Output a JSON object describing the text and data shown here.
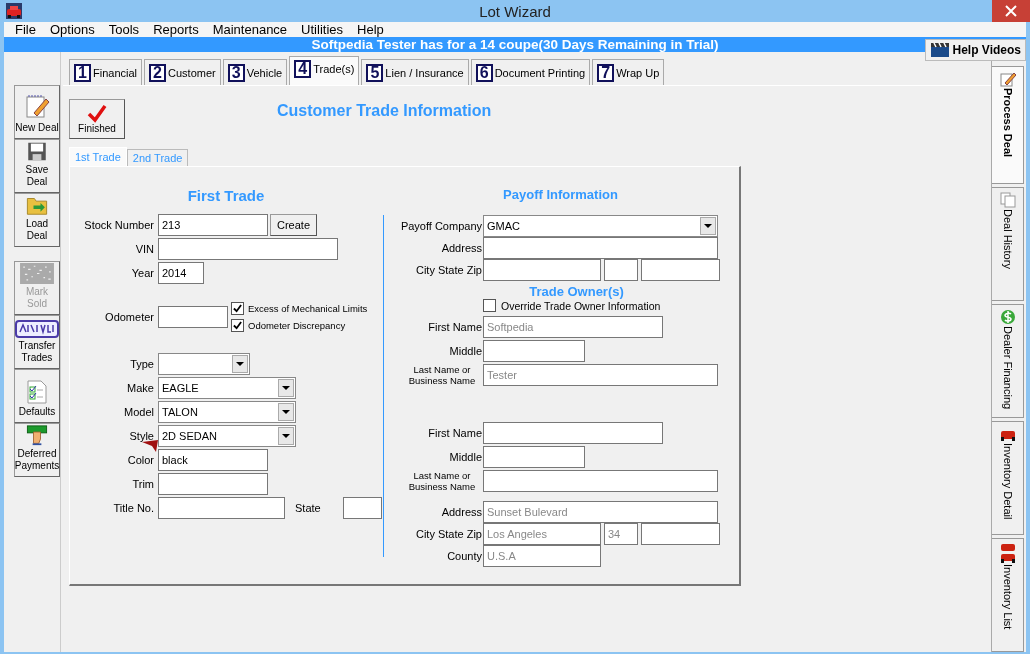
{
  "window": {
    "title": "Lot Wizard"
  },
  "menu": [
    "File",
    "Options",
    "Tools",
    "Reports",
    "Maintenance",
    "Utilities",
    "Help"
  ],
  "banner": {
    "text": "Softpedia Tester has  for a 14  coupe(30 Days Remaining in Trial)",
    "help_button": "Help Videos"
  },
  "tabs": [
    {
      "number": "1",
      "label": "Financial",
      "selected": false
    },
    {
      "number": "2",
      "label": "Customer",
      "selected": false
    },
    {
      "number": "3",
      "label": "Vehicle",
      "selected": false
    },
    {
      "number": "4",
      "label": "Trade(s)",
      "selected": true
    },
    {
      "number": "5",
      "label": "Lien / Insurance",
      "selected": false
    },
    {
      "number": "6",
      "label": "Document Printing",
      "selected": false
    },
    {
      "number": "7",
      "label": "Wrap Up",
      "selected": false
    }
  ],
  "sidebar": [
    {
      "label": "New Deal",
      "kind": "new",
      "disabled": false
    },
    {
      "label": "Save Deal",
      "kind": "save",
      "disabled": false
    },
    {
      "label": "Load Deal",
      "kind": "load",
      "disabled": false
    },
    {
      "label": "Mark Sold",
      "kind": "sold",
      "disabled": true
    },
    {
      "label": "Transfer Trades",
      "kind": "stamp",
      "disabled": false
    },
    {
      "label": "Defaults",
      "kind": "checklist",
      "disabled": false
    },
    {
      "label": "Deferred Payments",
      "kind": "money",
      "disabled": false
    }
  ],
  "side_tabs": [
    {
      "label": "Process Deal",
      "kind": "pencil",
      "selected": true
    },
    {
      "label": "Deal History",
      "kind": "pages",
      "selected": false
    },
    {
      "label": "Dealer Financing",
      "kind": "dollar",
      "selected": false
    },
    {
      "label": "Inventory Detail",
      "kind": "car",
      "selected": false
    },
    {
      "label": "Inventory List",
      "kind": "cars",
      "selected": false
    }
  ],
  "finished_button": "Finished",
  "page_title": "Customer Trade Information",
  "trade_tabs": [
    {
      "label": "1st Trade",
      "selected": true
    },
    {
      "label": "2nd Trade",
      "selected": false
    }
  ],
  "first_trade": {
    "title": "First Trade",
    "create_button": "Create",
    "stock_number": {
      "label": "Stock Number",
      "value": "213"
    },
    "vin": {
      "label": "VIN"
    },
    "year": {
      "label": "Year",
      "value": "2014"
    },
    "odometer": {
      "label": "Odometer"
    },
    "checks": [
      {
        "label": "Excess of Mechanical Limits",
        "checked": true
      },
      {
        "label": "Odometer Discrepancy",
        "checked": true
      }
    ],
    "type": {
      "label": "Type"
    },
    "make": {
      "label": "Make",
      "value": "EAGLE"
    },
    "model": {
      "label": "Model",
      "value": "TALON"
    },
    "style": {
      "label": "Style",
      "value": "2D SEDAN"
    },
    "color": {
      "label": "Color",
      "value": "black"
    },
    "trim": {
      "label": "Trim"
    },
    "title_no": {
      "label": "Title No."
    },
    "state": {
      "label": "State"
    }
  },
  "payoff": {
    "title": "Payoff Information",
    "company": {
      "label": "Payoff Company",
      "value": "GMAC"
    },
    "address": {
      "label": "Address"
    },
    "city_state_zip": {
      "label": "City State Zip"
    }
  },
  "trade_owners": {
    "title": "Trade Owner(s)",
    "override": {
      "label": "Override Trade Owner Information",
      "checked": false
    },
    "owners": [
      {
        "first_name": {
          "label": "First Name",
          "value": "Softpedia"
        },
        "middle": {
          "label": "Middle"
        },
        "last_name": {
          "label": "Last Name or Business Name",
          "value": "Tester"
        }
      },
      {
        "first_name": {
          "label": "First Name"
        },
        "middle": {
          "label": "Middle"
        },
        "last_name": {
          "label": "Last Name or Business Name"
        }
      }
    ],
    "address": {
      "label": "Address",
      "value": "Sunset Bulevard"
    },
    "city_state_zip": {
      "label": "City State Zip",
      "city": "Los Angeles",
      "state": "34"
    },
    "county": {
      "label": "County",
      "value": "U.S.A"
    }
  }
}
